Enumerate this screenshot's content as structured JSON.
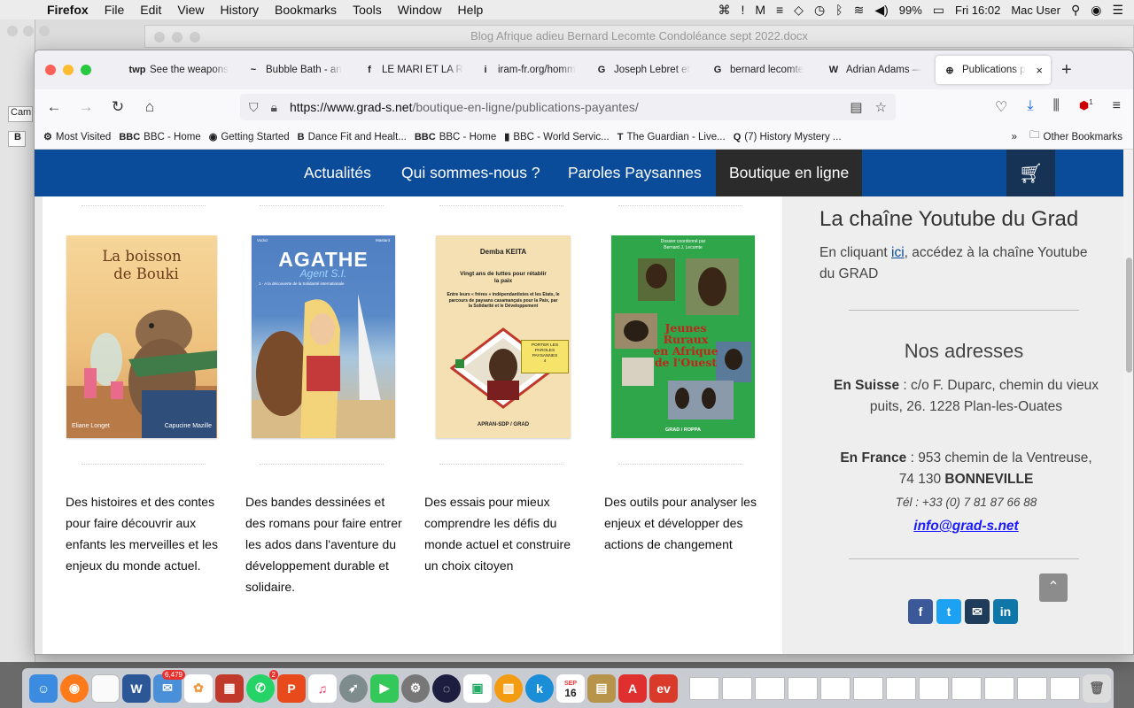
{
  "menubar": {
    "app": "Firefox",
    "items": [
      "File",
      "Edit",
      "View",
      "History",
      "Bookmarks",
      "Tools",
      "Window",
      "Help"
    ],
    "battery": "99%",
    "clock": "Fri 16:02",
    "user": "Mac User"
  },
  "background_window": {
    "title": "Blog Afrique adieu Bernard Lecomte Condoléance sept 2022.docx",
    "font_box": "Cam",
    "bold_box": "B"
  },
  "browser": {
    "tabs": [
      {
        "icon": "twp",
        "label": "See the weapons"
      },
      {
        "icon": "~",
        "label": "Bubble Bath - an"
      },
      {
        "icon": "f",
        "label": "LE MARI ET LA RE"
      },
      {
        "icon": "i",
        "label": "iram-fr.org/homm"
      },
      {
        "icon": "G",
        "label": "Joseph Lebret et"
      },
      {
        "icon": "G",
        "label": "bernard lecomte"
      },
      {
        "icon": "W",
        "label": "Adrian Adams —"
      },
      {
        "icon": "⊕",
        "label": "Publications p"
      }
    ],
    "url_host": "https://www.grad-s.net",
    "url_path": "/boutique-en-ligne/publications-payantes/",
    "bookmarks": [
      {
        "icon": "⚙",
        "label": "Most Visited"
      },
      {
        "icon": "BBC",
        "label": "BBC - Home"
      },
      {
        "icon": "◉",
        "label": "Getting Started"
      },
      {
        "icon": "B",
        "label": "Dance Fit and Healt..."
      },
      {
        "icon": "BBC",
        "label": "BBC - Home"
      },
      {
        "icon": "▮",
        "label": "BBC - World Servic..."
      },
      {
        "icon": "T",
        "label": "The Guardian - Live..."
      },
      {
        "icon": "Q",
        "label": "(7) History Mystery ..."
      }
    ],
    "other_bookmarks": "Other Bookmarks",
    "notif_count": "1"
  },
  "site": {
    "nav": [
      "Actualités",
      "Qui sommes-nous ?",
      "Paroles Paysannes",
      "Boutique en ligne"
    ],
    "books": [
      {
        "title_l1": "La boisson",
        "title_l2": "de Bouki",
        "author_left": "Eliane Longet",
        "author_right": "Capucine Mazille",
        "desc": "Des histoires et des contes pour faire découvrir aux enfants les merveilles et les enjeux du monde actuel."
      },
      {
        "author_left": "Vodoz",
        "author_right": "Mastant",
        "title": "AGATHE",
        "subtitle": "Agent S.I.",
        "tagline": "1 - A la découverte de la Solidarité internationale",
        "desc": "Des bandes dessinées et des romans pour faire entrer les ados dans l'aventure du développement durable et solidaire."
      },
      {
        "author": "Demba KEITA",
        "title": "Vingt ans de luttes pour rétablir la paix",
        "blurb": "Entre leurs « frères » indépendantistes et les Etats, le parcours de paysans casamançais pour la Paix, par la Solidarité et le Développement",
        "series": "PORTER LES PAROLES PAYSANNES",
        "series_no": "4",
        "publisher": "APRAN-SDP / GRAD",
        "desc": "Des essais pour mieux comprendre les défis du monde actuel et construire un choix citoyen"
      },
      {
        "header_l1": "Dossier coordonné par",
        "header_l2": "Bernard J. Lecomte",
        "title_l1": "Jeunes",
        "title_l2": "Ruraux",
        "title_l3": "en Afrique",
        "title_l4": "de l'Ouest",
        "publisher": "GRAD / ROPPA",
        "desc": "Des outils pour analyser les enjeux et développer des actions de changement"
      }
    ],
    "sidebar": {
      "yt_title": "La chaîne Youtube du Grad",
      "yt_text_before": "En cliquant ",
      "yt_link": "ici",
      "yt_text_after": ", accédez à la chaîne Youtube du GRAD",
      "addr_title": "Nos adresses",
      "swiss_label": "En Suisse",
      "swiss_addr": " : c/o F. Duparc, chemin du vieux puits, 26. 1228 Plan-les-Ouates",
      "france_label": "En France",
      "france_addr_l1": " : 953 chemin de la Ventreuse,",
      "france_addr_l2a": "74 130 ",
      "france_addr_l2b": "BONNEVILLE",
      "tel": "Tél : +33 (0) 7 81 87 66 88",
      "email": "info@grad-s.net",
      "social": [
        "f",
        "t",
        "✉",
        "in"
      ]
    }
  },
  "dock": {
    "mail_badge": "6,479",
    "whatsapp_badge": "2",
    "calendar_month": "SEP",
    "calendar_day": "16"
  }
}
